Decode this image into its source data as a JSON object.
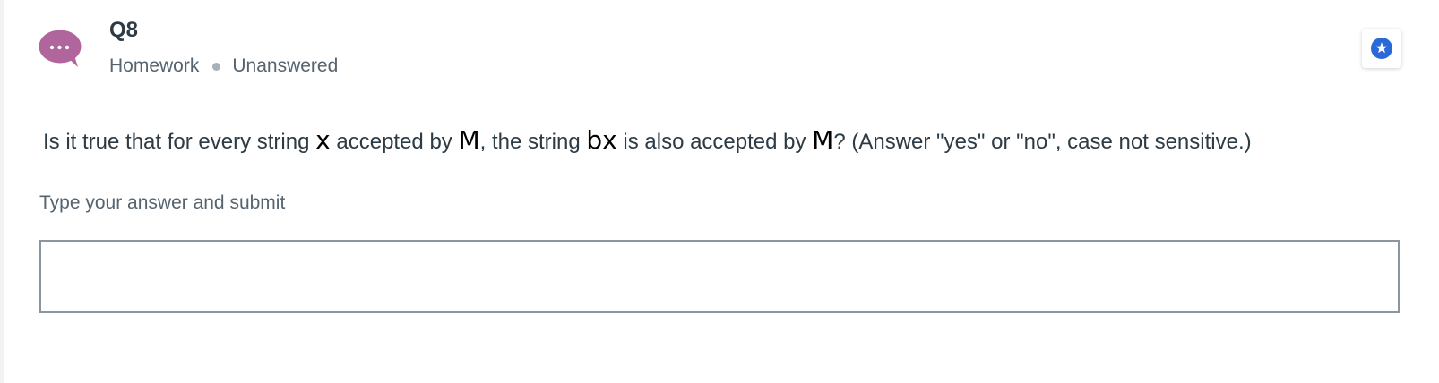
{
  "question": {
    "title": "Q8",
    "category": "Homework",
    "status": "Unanswered",
    "text_parts": {
      "p1": "Is it true that for every string ",
      "var_x": "x",
      "p2": " accepted by ",
      "var_M1": "M",
      "p3": ", the string ",
      "var_bx": "bx",
      "p4": " is also accepted by ",
      "var_M2": "M",
      "p5": "? (Answer \"yes\" or \"no\", case not sensitive.)"
    }
  },
  "answer": {
    "label": "Type your answer and submit",
    "value": "",
    "placeholder": ""
  },
  "icons": {
    "avatar": "chat-bubble-icon",
    "bookmark": "star-icon"
  },
  "colors": {
    "avatar_purple": "#b0659d",
    "star_blue": "#2a6ad8",
    "text_dark": "#2d3b45",
    "text_muted": "#56646f"
  }
}
